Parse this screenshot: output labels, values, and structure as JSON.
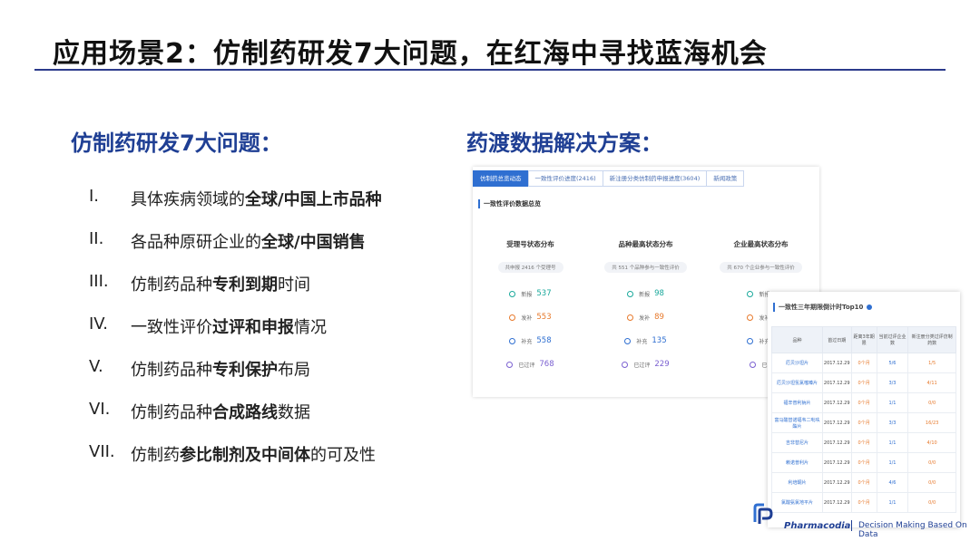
{
  "title": "应用场景2：仿制药研发7大问题，在红海中寻找蓝海机会",
  "left_heading": "仿制药研发7大问题：",
  "right_heading": "药渡数据解决方案：",
  "problems": [
    {
      "num": "I.",
      "pre": "具体疾病领域的",
      "bold": "全球/中国上市品种",
      "post": ""
    },
    {
      "num": "II.",
      "pre": "各品种原研企业的",
      "bold": "全球/中国销售",
      "post": ""
    },
    {
      "num": "III.",
      "pre": "仿制药品种",
      "bold": "专利到期",
      "post": "时间"
    },
    {
      "num": "IV.",
      "pre": "一致性评价",
      "bold": "过评和申报",
      "post": "情况"
    },
    {
      "num": "V.",
      "pre": "仿制药品种",
      "bold": "专利保护",
      "post": "布局"
    },
    {
      "num": "VI.",
      "pre": "仿制药品种",
      "bold": "合成路线",
      "post": "数据"
    },
    {
      "num": "VII.",
      "pre": "仿制药",
      "bold": "参比制剂及中间体",
      "post": "的可及性"
    }
  ],
  "panel1": {
    "tabs": [
      "仿制药总览动态",
      "一致性评价进度(2416)",
      "新注册分类仿制药申报进度(3604)",
      "新闻政策"
    ],
    "subtitle": "一致性评价数据总览",
    "columns": [
      {
        "heading": "受理号状态分布",
        "pill": "共申报 2416 个受理号",
        "stats": [
          {
            "label": "新报",
            "value": "537",
            "color": "#19a89b"
          },
          {
            "label": "发补",
            "value": "553",
            "color": "#e7792b"
          },
          {
            "label": "补充",
            "value": "558",
            "color": "#2f6fd1"
          },
          {
            "label": "已过评",
            "value": "768",
            "color": "#7b61d1"
          }
        ]
      },
      {
        "heading": "品种最高状态分布",
        "pill": "共 551 个品种参与一致性评价",
        "stats": [
          {
            "label": "新报",
            "value": "98",
            "color": "#19a89b"
          },
          {
            "label": "发补",
            "value": "89",
            "color": "#e7792b"
          },
          {
            "label": "补充",
            "value": "135",
            "color": "#2f6fd1"
          },
          {
            "label": "已过评",
            "value": "229",
            "color": "#7b61d1"
          }
        ]
      },
      {
        "heading": "企业最高状态分布",
        "pill": "共 670 个企业参与一致性评价",
        "stats": [
          {
            "label": "新报",
            "value": "",
            "color": "#19a89b"
          },
          {
            "label": "发补",
            "value": "",
            "color": "#e7792b"
          },
          {
            "label": "补充",
            "value": "",
            "color": "#2f6fd1"
          },
          {
            "label": "已",
            "value": "",
            "color": "#7b61d1"
          }
        ]
      }
    ]
  },
  "panel2": {
    "title": "一致性三年期限倒计时Top10",
    "headers": [
      "品种",
      "首过日期",
      "距离3年期限",
      "当前过评企业数",
      "新注册分类过评仿制药数"
    ],
    "rows": [
      [
        "厄贝沙坦片",
        "2017.12.29",
        "0个月",
        "5/6",
        "1/5"
      ],
      [
        "厄贝沙坦氢氯噻嗪片",
        "2017.12.29",
        "0个月",
        "3/3",
        "4/11"
      ],
      [
        "福辛普利钠片",
        "2017.12.29",
        "0个月",
        "1/1",
        "0/0"
      ],
      [
        "富马酸替诺福韦二吡呋酯片",
        "2017.12.29",
        "0个月",
        "3/3",
        "16/23"
      ],
      [
        "吉非替尼片",
        "2017.12.29",
        "0个月",
        "1/1",
        "4/10"
      ],
      [
        "赖诺普利片",
        "2017.12.29",
        "0个月",
        "1/1",
        "0/0"
      ],
      [
        "利培酮片",
        "2017.12.29",
        "0个月",
        "4/6",
        "0/0"
      ],
      [
        "氯酸氨氯地平片",
        "2017.12.29",
        "0个月",
        "1/1",
        "0/0"
      ]
    ]
  },
  "brand": {
    "name": "Pharmacodia",
    "tagline": "Decision Making Based On Data"
  }
}
